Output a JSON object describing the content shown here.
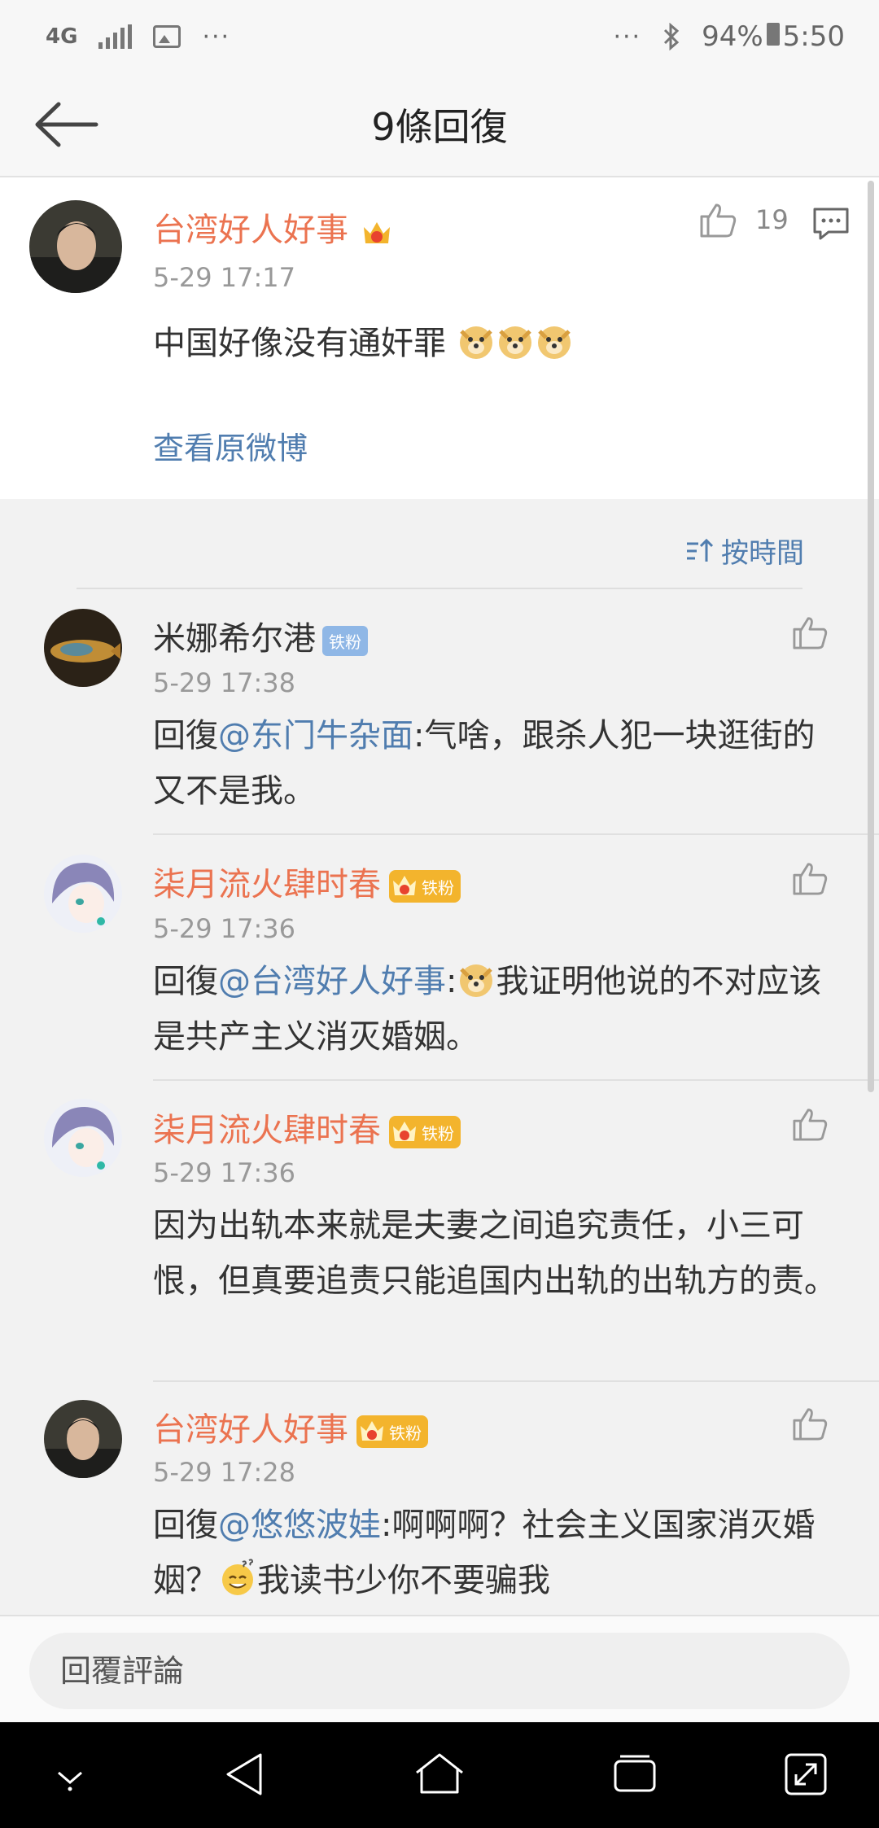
{
  "status_bar": {
    "network": "4G",
    "dots_left": "···",
    "dots_right": "···",
    "battery": "94%",
    "time": "5:50"
  },
  "header": {
    "title": "9條回復"
  },
  "post": {
    "author": "台湾好人好事",
    "time": "5-29 17:17",
    "text": "中国好像没有通奸罪",
    "likes": "19",
    "view_original": "查看原微博"
  },
  "sort": {
    "label": "按時間"
  },
  "replies": [
    {
      "author": "米娜希尔港",
      "badge": "铁粉",
      "time": "5-29 17:38",
      "prefix": "回復",
      "mention": "@东门牛杂面",
      "text": ":气啥，跟杀人犯一块逛街的又不是我。"
    },
    {
      "author": "柒月流火肆时春",
      "badge": "铁粉",
      "time": "5-29 17:36",
      "prefix": "回復",
      "mention": "@台湾好人好事",
      "text_a": ":",
      "text_b": "我证明他说的不对应该是共产主义消灭婚姻。"
    },
    {
      "author": "柒月流火肆时春",
      "badge": "铁粉",
      "time": "5-29 17:36",
      "text": "因为出轨本来就是夫妻之间追究责任，小三可恨，但真要追责只能追国内出轨的出轨方的责。"
    },
    {
      "author": "台湾好人好事",
      "badge": "铁粉",
      "time": "5-29 17:28",
      "prefix": "回復",
      "mention": "@悠悠波娃",
      "text_a": ":啊啊啊？社会主义国家消灭婚姻？",
      "text_b": "我读书少你不要骗我"
    }
  ],
  "reply_box": {
    "placeholder": "回覆評論"
  },
  "colors": {
    "name_orange": "#eb7350",
    "link_blue": "#507daf",
    "badge_blue": "#8fb7e6",
    "crown_gold": "#f3b42d"
  }
}
